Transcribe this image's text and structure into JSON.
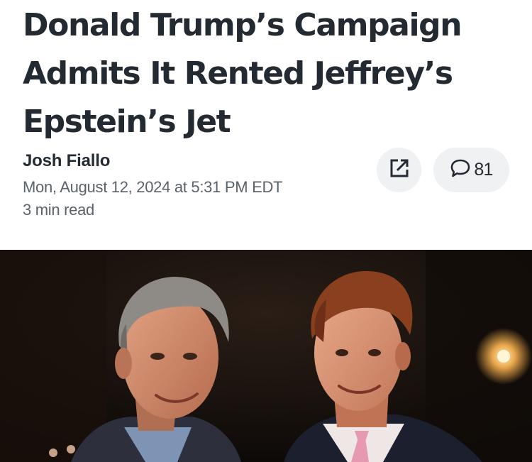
{
  "article": {
    "headline": "Donald Trump’s Campaign Admits It Rented Jeffrey’s Epstein’s Jet",
    "author": "Josh Fiallo",
    "date": "Mon, August 12, 2024 at 5:31 PM EDT",
    "read_time": "3 min read"
  },
  "actions": {
    "share_icon": "share-external-icon",
    "comment_icon": "comment-bubble-icon",
    "comment_count": "81"
  },
  "photo": {
    "subject": "two men posing at an evening event"
  }
}
